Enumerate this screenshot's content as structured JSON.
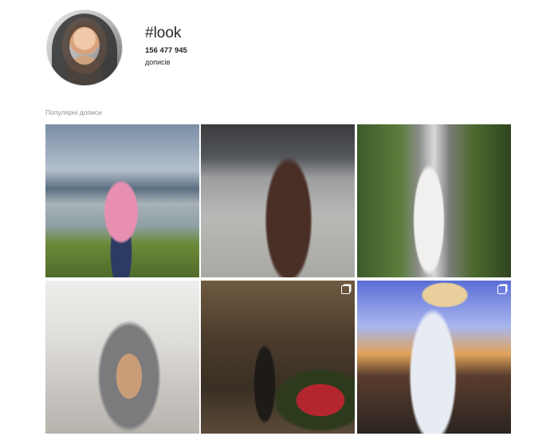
{
  "header": {
    "avatar_alt": "avatar",
    "hashtag": "#look",
    "post_count": "156 477 945",
    "post_word": "дописів"
  },
  "sections": {
    "popular_label": "Популярні дописи"
  },
  "posts": [
    {
      "kind": "photo",
      "multi": false
    },
    {
      "kind": "photo",
      "multi": false
    },
    {
      "kind": "photo",
      "multi": false
    },
    {
      "kind": "photo",
      "multi": false
    },
    {
      "kind": "photo",
      "multi": true
    },
    {
      "kind": "photo",
      "multi": true
    }
  ],
  "colors": {
    "text": "#262626",
    "muted": "#8e8e8e",
    "background": "#ffffff"
  }
}
